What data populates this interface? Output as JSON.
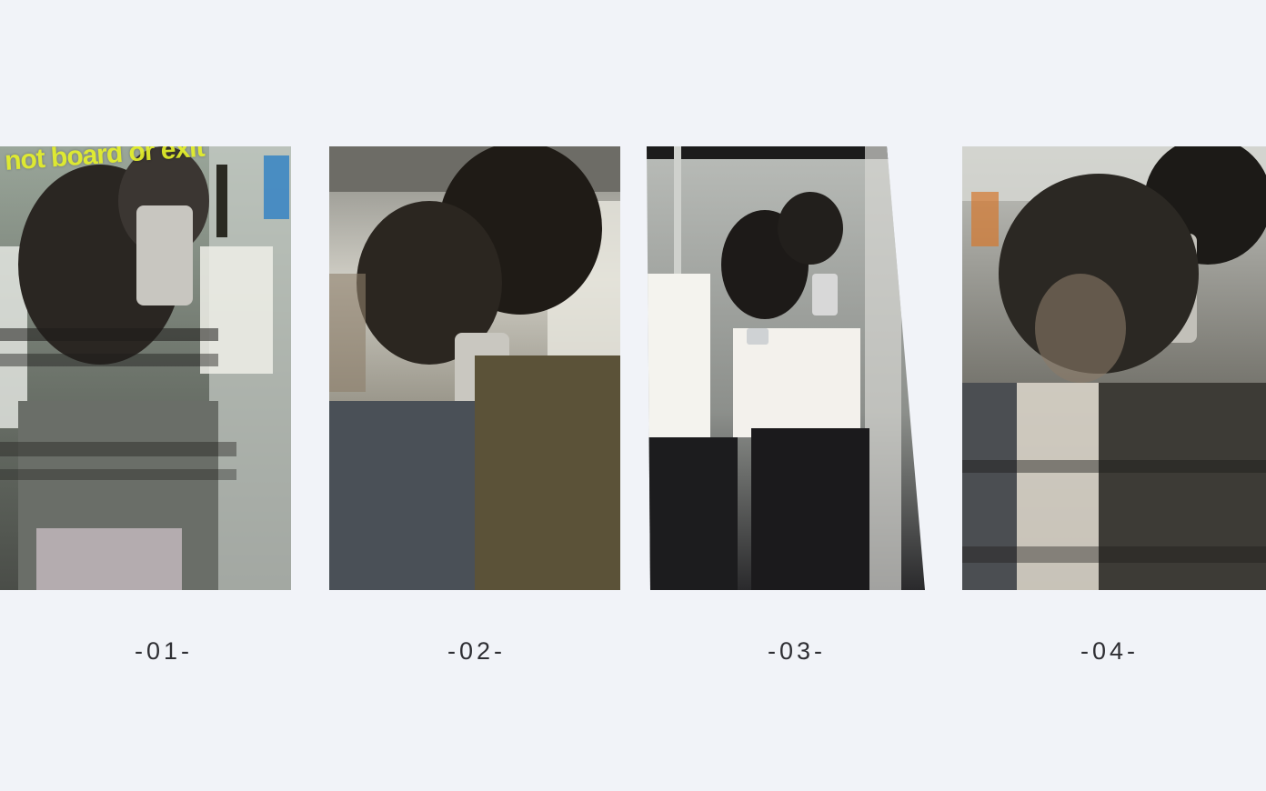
{
  "photos": [
    {
      "id": "photo-1",
      "caption": "-01-",
      "sign_text": "not board or exit"
    },
    {
      "id": "photo-2",
      "caption": "-02-"
    },
    {
      "id": "photo-3",
      "caption": "-03-"
    },
    {
      "id": "photo-4",
      "caption": "-04-"
    }
  ],
  "colors": {
    "background": "#f1f3f8",
    "caption_text": "#2e2e33",
    "sign_yellow": "#e4ef2a"
  }
}
